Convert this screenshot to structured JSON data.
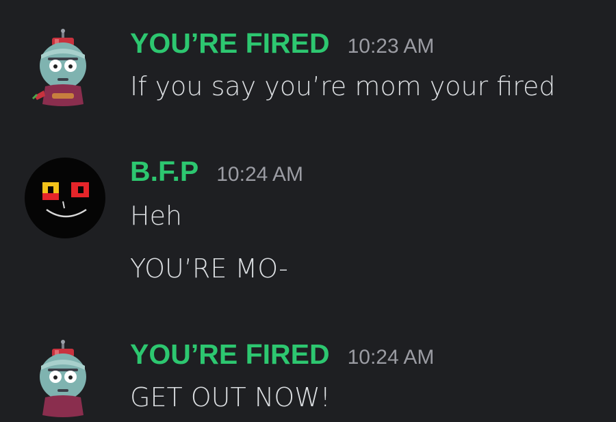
{
  "colors": {
    "background": "#1e1f22",
    "author_green": "#2dc770",
    "timestamp_gray": "#9b9ca3",
    "text": "#dbdee1"
  },
  "messages": [
    {
      "author": "YOU’RE FIRED",
      "time": "10:23 AM",
      "avatar_icon": "robot-avatar-icon",
      "lines": [
        "If you say you’re mom your fired"
      ]
    },
    {
      "author": "B.F.P",
      "time": "10:24 AM",
      "avatar_icon": "dark-face-avatar-icon",
      "lines": [
        "Heh",
        "YOU’RE MO-"
      ]
    },
    {
      "author": "YOU’RE FIRED",
      "time": "10:24 AM",
      "avatar_icon": "robot-avatar-icon",
      "lines": [
        "GET OUT NOW!"
      ]
    }
  ]
}
